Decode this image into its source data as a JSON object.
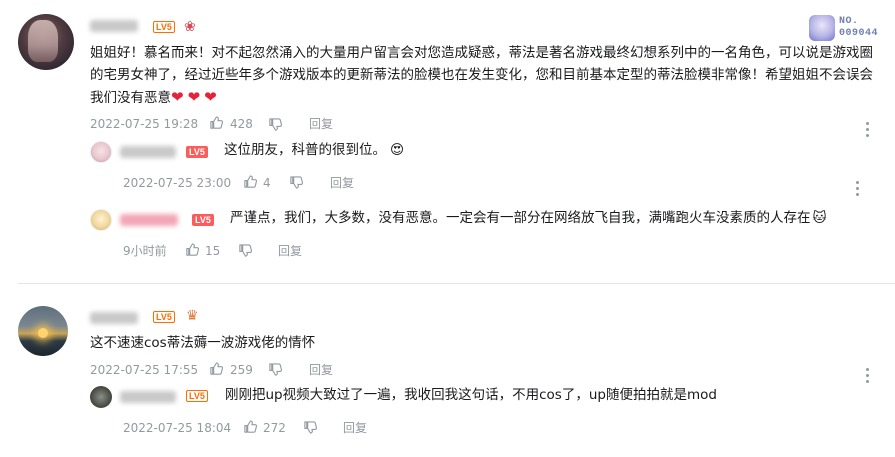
{
  "comment1": {
    "level": "LV5",
    "no_badge_line1": "NO.",
    "no_badge_line2": "009044",
    "text": "姐姐好！慕名而来！对不起忽然涌入的大量用户留言会对您造成疑惑，蒂法是著名游戏最终幻想系列中的一名角色，可以说是游戏圈的宅男女神了，经过近些年多个游戏版本的更新蒂法的脸模也在发生变化，您和目前基本定型的蒂法脸模非常像！希望姐姐不会误会我们没有恶意",
    "hearts": "❤❤❤",
    "time": "2022-07-25 19:28",
    "likes": "428",
    "reply_label": "回复",
    "replies": [
      {
        "level": "LV5",
        "text": "这位朋友，科普的很到位。",
        "emoji": "😍",
        "time": "2022-07-25 23:00",
        "likes": "4",
        "reply_label": "回复"
      },
      {
        "level": "LV5",
        "text": "严谨点，我们，大多数，没有恶意。一定会有一部分在网络放飞自我，满嘴跑火车没素质的人存在",
        "emoji": "🐱",
        "time": "9小时前",
        "likes": "15",
        "reply_label": "回复"
      }
    ]
  },
  "comment2": {
    "level": "LV5",
    "text": "这不速速cos蒂法薅一波游戏佬的情怀",
    "time": "2022-07-25 17:55",
    "likes": "259",
    "reply_label": "回复",
    "replies": [
      {
        "level": "LV5",
        "text": "刚刚把up视频大致过了一遍，我收回我这句话，不用cos了，up随便拍拍就是mod",
        "time": "2022-07-25 18:04",
        "likes": "272",
        "reply_label": "回复"
      }
    ]
  },
  "colors": {
    "level_orange": "#ff6c00",
    "level_red": "#fb5c5c",
    "meta_gray": "#9499a0",
    "text": "#18191c",
    "heart": "#e4233b"
  }
}
